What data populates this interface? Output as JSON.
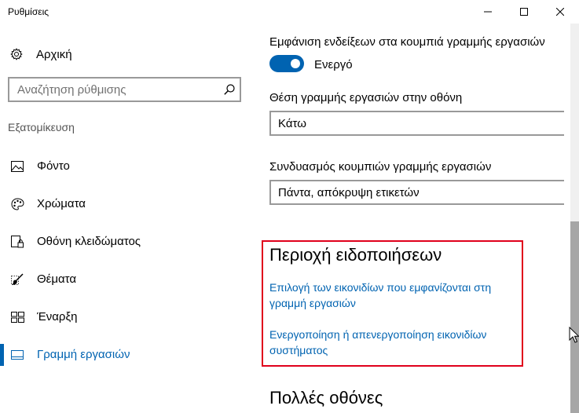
{
  "window": {
    "title": "Ρυθμίσεις"
  },
  "sidebar": {
    "home_label": "Αρχική",
    "search_placeholder": "Αναζήτηση ρύθμισης",
    "section_header": "Εξατομίκευση",
    "items": [
      {
        "label": "Φόντο",
        "icon": "picture-icon",
        "active": false
      },
      {
        "label": "Χρώματα",
        "icon": "palette-icon",
        "active": false
      },
      {
        "label": "Οθόνη κλειδώματος",
        "icon": "lock-screen-icon",
        "active": false
      },
      {
        "label": "Θέματα",
        "icon": "brush-icon",
        "active": false
      },
      {
        "label": "Έναρξη",
        "icon": "start-tiles-icon",
        "active": false
      },
      {
        "label": "Γραμμή εργασιών",
        "icon": "taskbar-icon",
        "active": true
      }
    ]
  },
  "main": {
    "badges_label": "Εμφάνιση ενδείξεων στα κουμπιά γραμμής εργασιών",
    "badges_toggle_state": "Ενεργό",
    "position_label": "Θέση γραμμής εργασιών στην οθόνη",
    "position_value": "Κάτω",
    "combine_label": "Συνδυασμός κουμπιών γραμμής εργασιών",
    "combine_value": "Πάντα, απόκρυψη ετικετών",
    "notification_area_title": "Περιοχή ειδοποιήσεων",
    "link_select_icons": "Επιλογή των εικονιδίων που εμφανίζονται στη γραμμή εργασιών",
    "link_system_icons": "Ενεργοποίηση ή απενεργοποίηση εικονιδίων συστήματος",
    "multiple_displays_title": "Πολλές οθόνες"
  },
  "colors": {
    "accent": "#0063b1",
    "highlight_border": "#e0001b"
  }
}
